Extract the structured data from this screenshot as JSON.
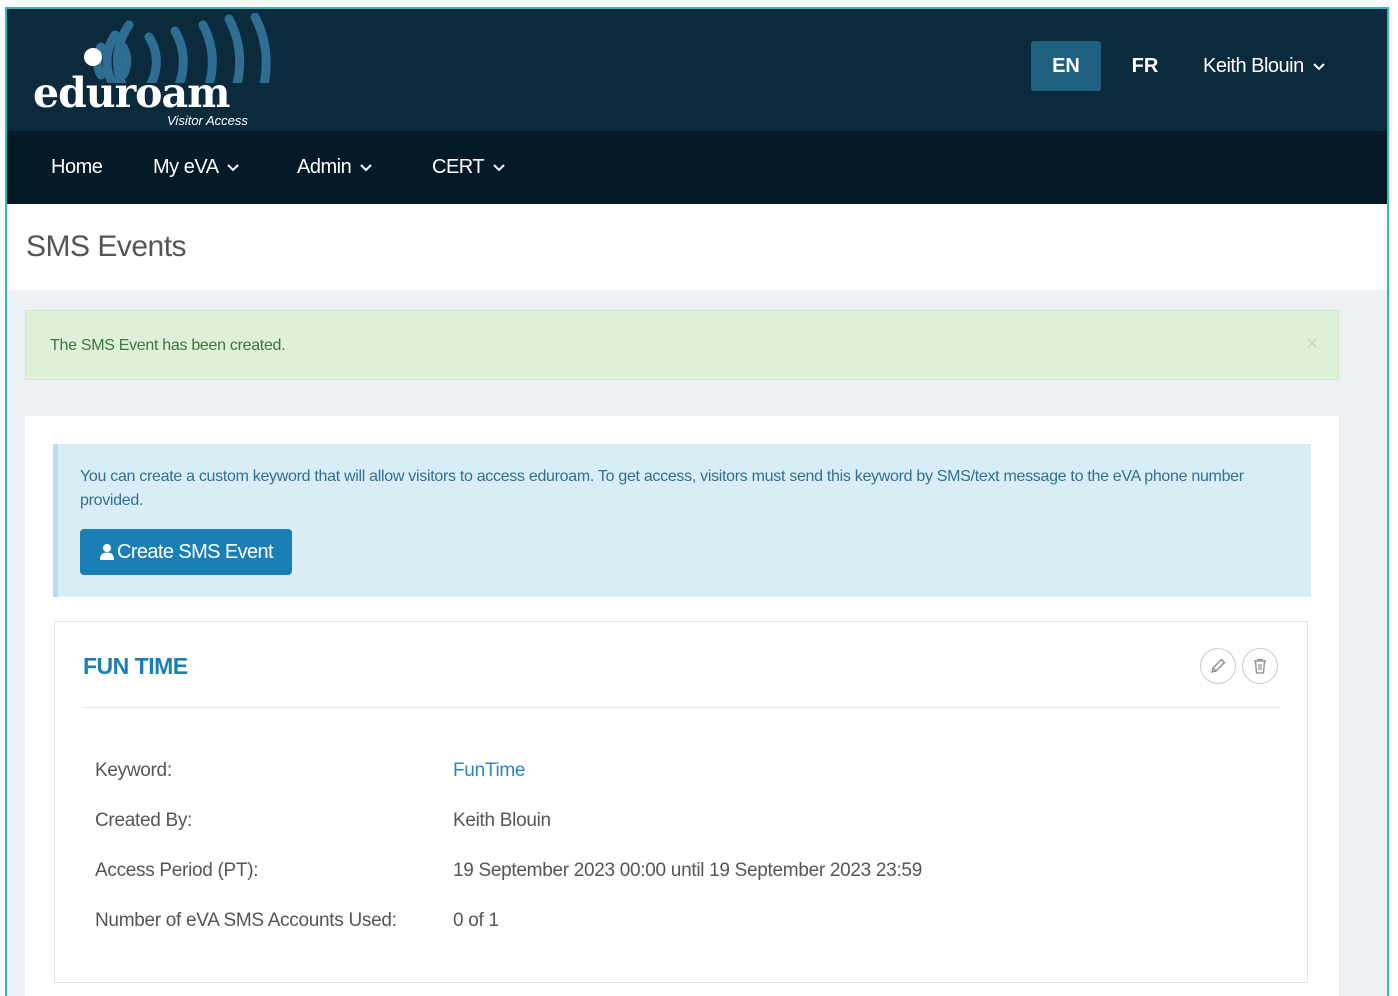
{
  "brand": {
    "logo_text": "eduroam",
    "logo_subtitle": "Visitor Access"
  },
  "header": {
    "languages": [
      {
        "label": "EN",
        "active": true
      },
      {
        "label": "FR",
        "active": false
      }
    ],
    "user_name": "Keith Blouin"
  },
  "nav": {
    "items": [
      {
        "label": "Home",
        "dropdown": false
      },
      {
        "label": "My eVA",
        "dropdown": true
      },
      {
        "label": "Admin",
        "dropdown": true
      },
      {
        "label": "CERT",
        "dropdown": true
      }
    ]
  },
  "page": {
    "title": "SMS Events"
  },
  "alert": {
    "message": "The SMS Event has been created.",
    "close_label": "×"
  },
  "info": {
    "text": "You can create a custom keyword that will allow visitors to access eduroam. To get access, visitors must send this keyword by SMS/text message to the eVA phone number provided.",
    "create_button_label": "Create SMS Event"
  },
  "event": {
    "title": "FUN TIME",
    "fields": [
      {
        "label": "Keyword:",
        "value": "FunTime"
      },
      {
        "label": "Created By:",
        "value": "Keith Blouin"
      },
      {
        "label": "Access Period (PT):",
        "value": "19 September 2023 00:00 until 19 September 2023 23:59"
      },
      {
        "label": "Number of eVA SMS Accounts Used:",
        "value": "0 of 1"
      }
    ]
  },
  "colors": {
    "header_bg": "#0b2a3c",
    "nav_bg": "#051a27",
    "accent": "#1a7fb5",
    "success_bg": "#dff0d8",
    "info_bg": "#d9edf7"
  }
}
